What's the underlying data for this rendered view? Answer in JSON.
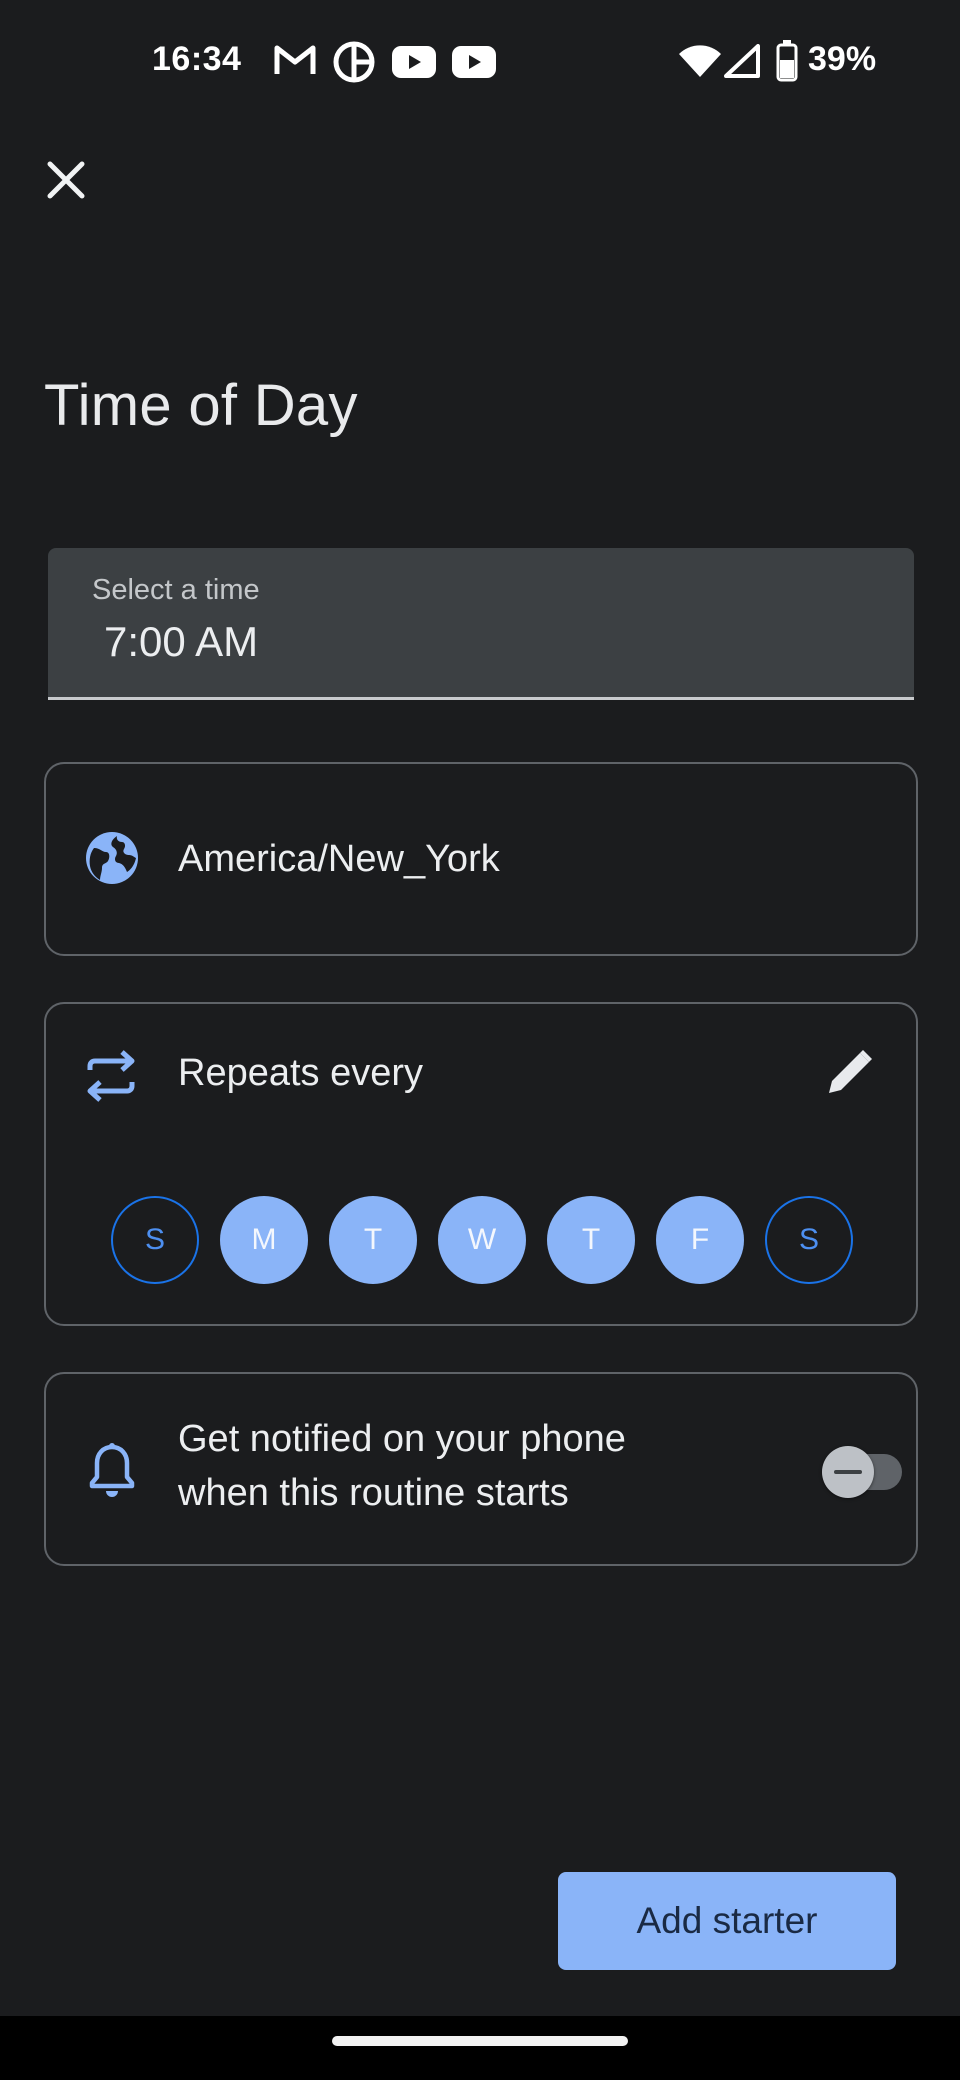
{
  "status_bar": {
    "time": "16:34",
    "battery_percent": "39%",
    "notification_icons": [
      "gmail-icon",
      "browser-icon",
      "youtube-icon",
      "youtube-icon"
    ]
  },
  "header": {
    "close_icon": "close-icon",
    "title": "Time of Day"
  },
  "time_field": {
    "label": "Select a time",
    "value": "7:00 AM"
  },
  "timezone": {
    "icon": "globe-icon",
    "value": "America/New_York"
  },
  "repeat": {
    "icon": "repeat-icon",
    "label": "Repeats every",
    "edit_icon": "pencil-icon",
    "days": [
      {
        "label": "S",
        "selected": false
      },
      {
        "label": "M",
        "selected": true
      },
      {
        "label": "T",
        "selected": true
      },
      {
        "label": "W",
        "selected": true
      },
      {
        "label": "T",
        "selected": true
      },
      {
        "label": "F",
        "selected": true
      },
      {
        "label": "S",
        "selected": false
      }
    ]
  },
  "notify": {
    "icon": "bell-icon",
    "line1": "Get notified on your phone",
    "line2": "when this routine starts",
    "enabled": false
  },
  "footer": {
    "add_button_label": "Add starter"
  },
  "colors": {
    "accent": "#8ab4f8",
    "background": "#1b1c1e",
    "outline_blue": "#1a73e8"
  }
}
